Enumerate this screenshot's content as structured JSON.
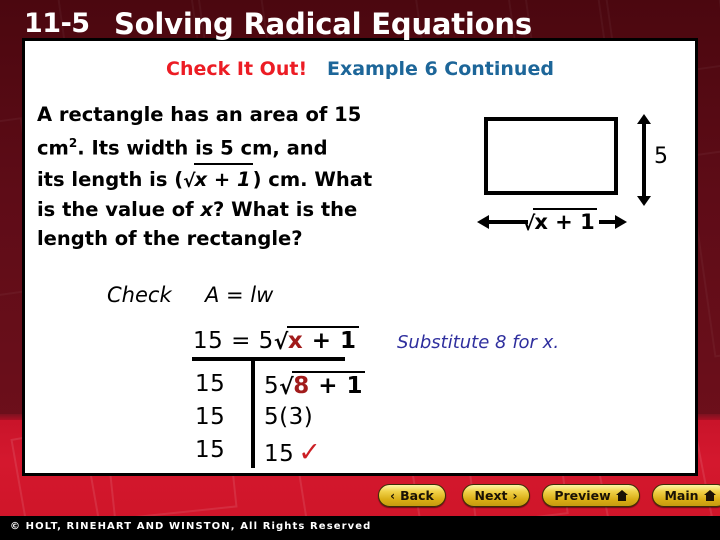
{
  "slide": {
    "lesson_number": "11-5",
    "lesson_title": "Solving Radical Equations",
    "header_primary": "Check It Out!",
    "header_secondary": "Example 6 Continued"
  },
  "problem": {
    "line1": "A rectangle has an area of 15",
    "line2_a": "cm",
    "line2_sup": "2",
    "line2_b": ". Its width is 5 cm, and",
    "line3_a": "its length is (",
    "line3_radical_sign": "√",
    "line3_radicand": "x + 1",
    "line3_b": ") cm. What",
    "line4_a": "is the value of ",
    "line4_var": "x",
    "line4_b": "? What is the",
    "line5": "length of the rectangle?"
  },
  "figure": {
    "height_label": "5",
    "width_radical_sign": "√",
    "width_radicand": "x + 1"
  },
  "work": {
    "check_label": "Check",
    "formula": "A = lw",
    "eq_left": "15 = 5",
    "eq_radical_sign": "√",
    "eq_radicand_var": "x",
    "eq_radicand_rest": " + 1",
    "rows": [
      {
        "left": "15",
        "right_prefix": "5",
        "right_radical_sign": "√",
        "right_radicand_var": "8",
        "right_radicand_rest": " + 1",
        "right_plain": "",
        "mark": ""
      },
      {
        "left": "15",
        "right_prefix": "",
        "right_radical_sign": "",
        "right_radicand_var": "",
        "right_radicand_rest": "",
        "right_plain": "5(3)",
        "mark": ""
      },
      {
        "left": "15",
        "right_prefix": "",
        "right_radical_sign": "",
        "right_radicand_var": "",
        "right_radicand_rest": "",
        "right_plain": "15",
        "mark": "✓"
      }
    ],
    "note": "Substitute 8 for x."
  },
  "nav": {
    "back": "Back",
    "next": "Next",
    "preview": "Preview",
    "main": "Main",
    "back_chevron": "‹",
    "next_chevron": "›"
  },
  "footer": {
    "copyright": "© HOLT, RINEHART AND WINSTON, All Rights Reserved"
  },
  "colors": {
    "header_red": "#ec1c24",
    "header_blue": "#1d6699",
    "note_blue": "#2f2f9e",
    "highlight_red": "#a11b1b",
    "check_red": "#cc1f24",
    "bg_maroon": "#5e0c17",
    "bg_red": "#d4182e",
    "button_gold": "#e8c233"
  }
}
